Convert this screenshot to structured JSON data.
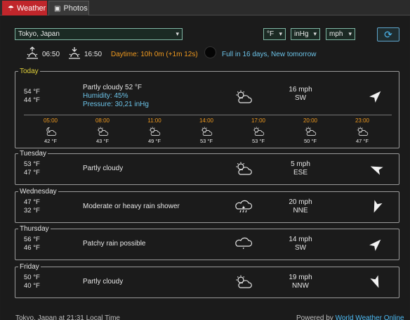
{
  "tabs": [
    {
      "label": "Weather",
      "icon": "umbrella-icon",
      "active": true
    },
    {
      "label": "Photos",
      "icon": "camera-icon",
      "active": false
    }
  ],
  "controls": {
    "location": "Tokyo, Japan",
    "temp_unit": "°F",
    "pressure_unit": "inHg",
    "speed_unit": "mph"
  },
  "sun": {
    "sunrise": "06:50",
    "sunset": "16:50",
    "daytime": "Daytime: 10h 0m (+1m 12s)",
    "moon": "Full in 16 days, New tomorrow"
  },
  "today": {
    "label": "Today",
    "high": "54 °F",
    "low": "44 °F",
    "condition": "Partly cloudy 52 °F",
    "humidity": "Humidity: 45%",
    "pressure": "Pressure: 30,21 inHg",
    "wind_speed": "16 mph",
    "wind_dir": "SW",
    "hours": [
      {
        "time": "05:00",
        "temp": "42 °F",
        "icon": "moon-cloud-icon"
      },
      {
        "time": "08:00",
        "temp": "43 °F",
        "icon": "partly-cloudy-icon"
      },
      {
        "time": "11:00",
        "temp": "49 °F",
        "icon": "partly-cloudy-icon"
      },
      {
        "time": "14:00",
        "temp": "53 °F",
        "icon": "partly-cloudy-icon"
      },
      {
        "time": "17:00",
        "temp": "53 °F",
        "icon": "partly-cloudy-icon"
      },
      {
        "time": "20:00",
        "temp": "50 °F",
        "icon": "partly-cloudy-icon"
      },
      {
        "time": "23:00",
        "temp": "47 °F",
        "icon": "partly-cloudy-icon"
      }
    ]
  },
  "days": [
    {
      "label": "Tuesday",
      "high": "53 °F",
      "low": "47 °F",
      "condition": "Partly cloudy",
      "icon": "partly-cloudy-icon",
      "wind_speed": "5 mph",
      "wind_dir": "ESE"
    },
    {
      "label": "Wednesday",
      "high": "47 °F",
      "low": "32 °F",
      "condition": "Moderate or heavy rain shower",
      "icon": "rain-cloud-icon",
      "wind_speed": "20 mph",
      "wind_dir": "NNE"
    },
    {
      "label": "Thursday",
      "high": "56 °F",
      "low": "46 °F",
      "condition": "Patchy rain possible",
      "icon": "drizzle-cloud-icon",
      "wind_speed": "14 mph",
      "wind_dir": "SW"
    },
    {
      "label": "Friday",
      "high": "50 °F",
      "low": "40 °F",
      "condition": "Partly cloudy",
      "icon": "partly-cloudy-icon",
      "wind_speed": "19 mph",
      "wind_dir": "NNW"
    }
  ],
  "footer": {
    "local_time": "Tokyo, Japan at 21:31 Local Time",
    "powered_by": "Powered by",
    "provider": "World Weather Online"
  }
}
